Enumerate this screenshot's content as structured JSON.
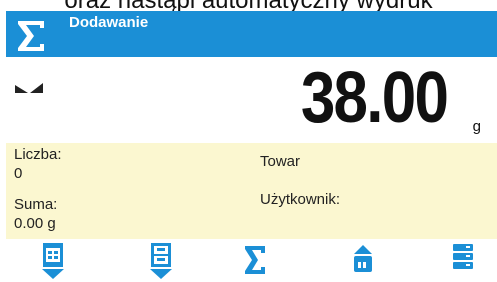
{
  "caption": {
    "text": "oraz nastąpi automatyczny wydruk"
  },
  "titlebar": {
    "title": "Dodawanie",
    "icon": "sigma-icon"
  },
  "weight": {
    "value": "38.00",
    "unit": "g",
    "stable_indicator": "stable-icon"
  },
  "info": {
    "count_label": "Liczba:",
    "count_value": "0",
    "sum_label": "Suma:",
    "sum_value": "0.00 g",
    "product_label": "Towar",
    "user_label": "Użytkownik:"
  },
  "toolbar": {
    "buttons": [
      {
        "icon": "tray-down-icon"
      },
      {
        "icon": "tray-add-icon"
      },
      {
        "icon": "sigma-icon"
      },
      {
        "icon": "product-icon"
      },
      {
        "icon": "database-icon"
      }
    ]
  },
  "colors": {
    "title_bar": "#1b8fd6",
    "info_background": "#fbf7d0",
    "icon_blue": "#1b8fd6"
  }
}
